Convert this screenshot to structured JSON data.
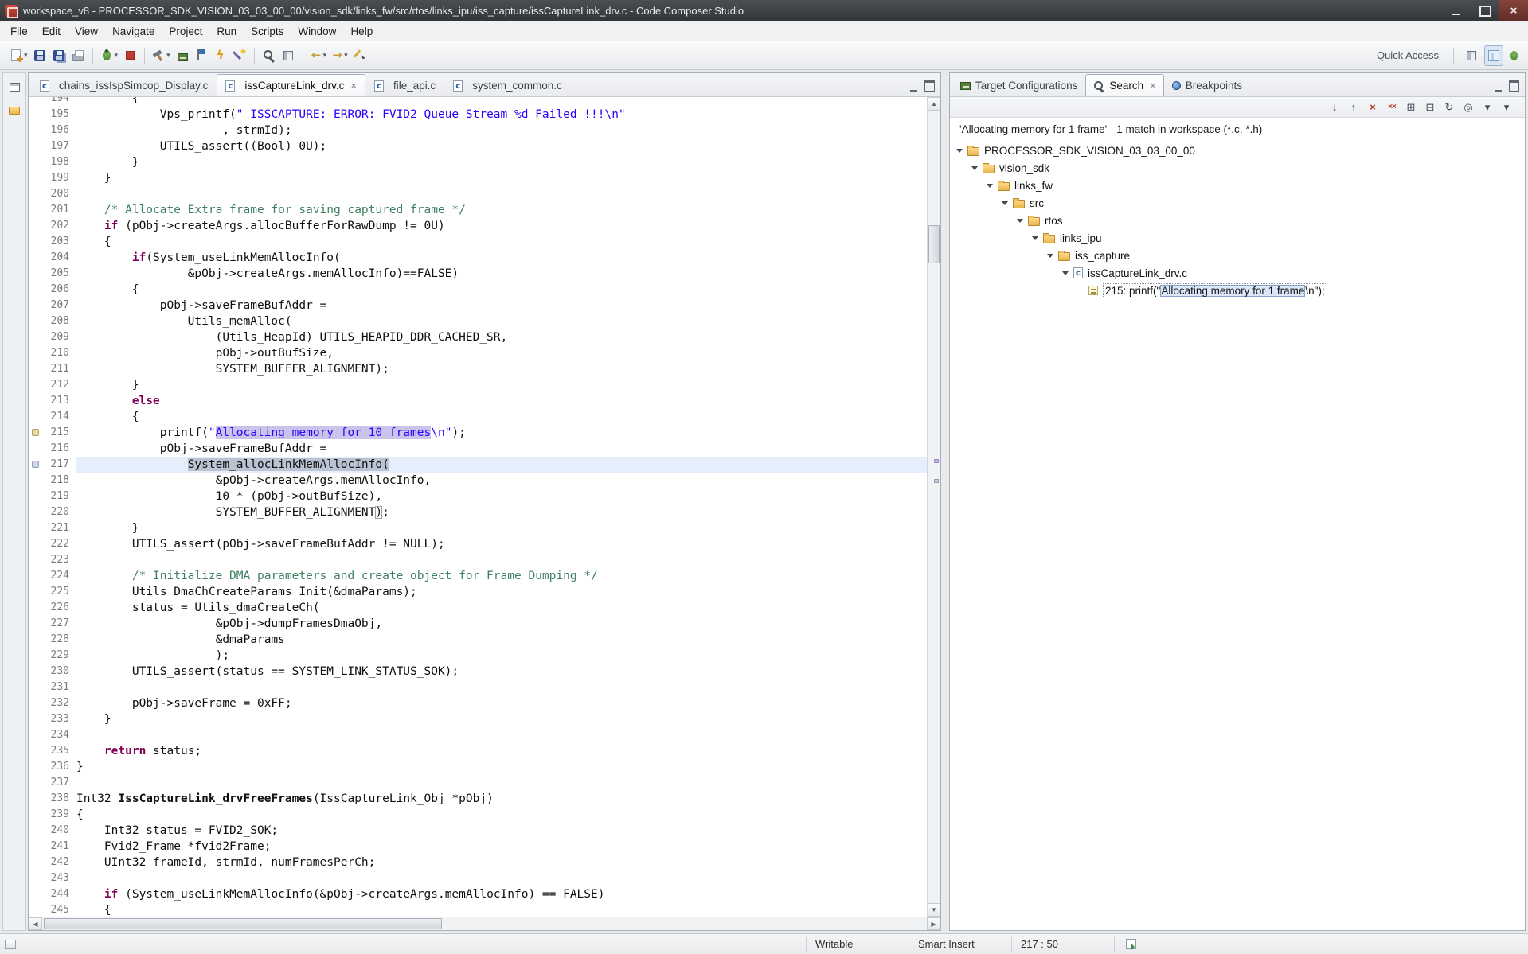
{
  "window": {
    "title": "workspace_v8 - PROCESSOR_SDK_VISION_03_03_00_00/vision_sdk/links_fw/src/rtos/links_ipu/iss_capture/issCaptureLink_drv.c - Code Composer Studio"
  },
  "menubar": {
    "items": [
      "File",
      "Edit",
      "View",
      "Navigate",
      "Project",
      "Run",
      "Scripts",
      "Window",
      "Help"
    ]
  },
  "toolbar": {
    "quick_access_label": "Quick Access",
    "buttons": [
      {
        "name": "new-button",
        "kind": "page",
        "dropdown": true
      },
      {
        "name": "save-button",
        "kind": "floppy"
      },
      {
        "name": "save-all-button",
        "kind": "floppy-all"
      },
      {
        "name": "print-button",
        "kind": "print"
      },
      {
        "sep": true
      },
      {
        "name": "debug-button",
        "kind": "bug",
        "dropdown": true
      },
      {
        "name": "stop-button",
        "kind": "stop"
      },
      {
        "sep": true
      },
      {
        "name": "build-button",
        "kind": "hammer",
        "dropdown": true
      },
      {
        "name": "new-target-configuration-button",
        "kind": "board"
      },
      {
        "name": "flag-button",
        "kind": "flag"
      },
      {
        "name": "flash-button",
        "kind": "bolt"
      },
      {
        "name": "wand-button",
        "kind": "wand"
      },
      {
        "sep": true
      },
      {
        "name": "search-button",
        "kind": "mag"
      },
      {
        "name": "open-resource-button",
        "kind": "grid"
      },
      {
        "sep": true
      },
      {
        "name": "back-button",
        "kind": "arrow-left",
        "dropdown": true
      },
      {
        "name": "forward-button",
        "kind": "arrow-right",
        "dropdown": true
      },
      {
        "name": "last-edit-location-button",
        "kind": "pencil"
      }
    ]
  },
  "editor": {
    "tabs": [
      {
        "label": "chains_issIspSimcop_Display.c",
        "active": false,
        "closable": false
      },
      {
        "label": "issCaptureLink_drv.c",
        "active": true,
        "closable": true
      },
      {
        "label": "file_api.c",
        "active": false,
        "closable": false
      },
      {
        "label": "system_common.c",
        "active": false,
        "closable": false
      }
    ],
    "code": {
      "lines": [
        {
          "n": 194,
          "segs": [
            {
              "t": "        {"
            }
          ]
        },
        {
          "n": 195,
          "segs": [
            {
              "t": "            Vps_printf("
            },
            {
              "t": "\" ISSCAPTURE: ERROR: FVID2 Queue Stream %d Failed !!!\\n\"",
              "c": "s"
            }
          ]
        },
        {
          "n": 196,
          "segs": [
            {
              "t": "                     , strmId);"
            }
          ]
        },
        {
          "n": 197,
          "segs": [
            {
              "t": "            UTILS_assert((Bool) 0U);"
            }
          ]
        },
        {
          "n": 198,
          "segs": [
            {
              "t": "        }"
            }
          ]
        },
        {
          "n": 199,
          "segs": [
            {
              "t": "    }"
            }
          ]
        },
        {
          "n": 200,
          "segs": []
        },
        {
          "n": 201,
          "segs": [
            {
              "t": "    "
            },
            {
              "t": "/* Allocate Extra frame for saving captured frame */",
              "c": "c"
            }
          ]
        },
        {
          "n": 202,
          "segs": [
            {
              "t": "    "
            },
            {
              "t": "if",
              "c": "k"
            },
            {
              "t": " (pObj->createArgs.allocBufferForRawDump != 0U)"
            }
          ]
        },
        {
          "n": 203,
          "segs": [
            {
              "t": "    {"
            }
          ]
        },
        {
          "n": 204,
          "segs": [
            {
              "t": "        "
            },
            {
              "t": "if",
              "c": "k"
            },
            {
              "t": "(System_useLinkMemAllocInfo("
            }
          ]
        },
        {
          "n": 205,
          "segs": [
            {
              "t": "                &pObj->createArgs.memAllocInfo)==FALSE)"
            }
          ]
        },
        {
          "n": 206,
          "segs": [
            {
              "t": "        {"
            }
          ]
        },
        {
          "n": 207,
          "segs": [
            {
              "t": "            pObj->saveFrameBufAddr ="
            }
          ]
        },
        {
          "n": 208,
          "segs": [
            {
              "t": "                Utils_memAlloc("
            }
          ]
        },
        {
          "n": 209,
          "segs": [
            {
              "t": "                    (Utils_HeapId) UTILS_HEAPID_DDR_CACHED_SR,"
            }
          ]
        },
        {
          "n": 210,
          "segs": [
            {
              "t": "                    pObj->outBufSize,"
            }
          ]
        },
        {
          "n": 211,
          "segs": [
            {
              "t": "                    SYSTEM_BUFFER_ALIGNMENT);"
            }
          ]
        },
        {
          "n": 212,
          "segs": [
            {
              "t": "        }"
            }
          ]
        },
        {
          "n": 213,
          "segs": [
            {
              "t": "        "
            },
            {
              "t": "else",
              "c": "k"
            }
          ]
        },
        {
          "n": 214,
          "segs": [
            {
              "t": "        {"
            }
          ]
        },
        {
          "n": 215,
          "marker": "search",
          "segs": [
            {
              "t": "            printf("
            },
            {
              "t": "\"",
              "c": "s"
            },
            {
              "t": "Allocating memory for 10 frames",
              "c": "s hl"
            },
            {
              "t": "\\n\"",
              "c": "s"
            },
            {
              "t": ");"
            }
          ]
        },
        {
          "n": 216,
          "segs": [
            {
              "t": "            pObj->saveFrameBufAddr ="
            }
          ]
        },
        {
          "n": 217,
          "cur": true,
          "marker": "occ",
          "segs": [
            {
              "t": "                "
            },
            {
              "t": "System_allocLinkMemAllocInfo(",
              "c": "sel"
            }
          ]
        },
        {
          "n": 218,
          "segs": [
            {
              "t": "                    &pObj->createArgs.memAllocInfo,"
            }
          ]
        },
        {
          "n": 219,
          "segs": [
            {
              "t": "                    10 * (pObj->outBufSize),"
            }
          ]
        },
        {
          "n": 220,
          "segs": [
            {
              "t": "                    SYSTEM_BUFFER_ALIGNMENT"
            },
            {
              "t": ")",
              "c": "br"
            },
            {
              "t": ";"
            }
          ]
        },
        {
          "n": 221,
          "segs": [
            {
              "t": "        }"
            }
          ]
        },
        {
          "n": 222,
          "segs": [
            {
              "t": "        UTILS_assert(pObj->saveFrameBufAddr != NULL);"
            }
          ]
        },
        {
          "n": 223,
          "segs": []
        },
        {
          "n": 224,
          "segs": [
            {
              "t": "        "
            },
            {
              "t": "/* Initialize DMA parameters and create object for Frame Dumping */",
              "c": "c"
            }
          ]
        },
        {
          "n": 225,
          "segs": [
            {
              "t": "        Utils_DmaChCreateParams_Init(&dmaParams);"
            }
          ]
        },
        {
          "n": 226,
          "segs": [
            {
              "t": "        status = Utils_dmaCreateCh("
            }
          ]
        },
        {
          "n": 227,
          "segs": [
            {
              "t": "                    &pObj->dumpFramesDmaObj,"
            }
          ]
        },
        {
          "n": 228,
          "segs": [
            {
              "t": "                    &dmaParams"
            }
          ]
        },
        {
          "n": 229,
          "segs": [
            {
              "t": "                    );"
            }
          ]
        },
        {
          "n": 230,
          "segs": [
            {
              "t": "        UTILS_assert(status == SYSTEM_LINK_STATUS_SOK);"
            }
          ]
        },
        {
          "n": 231,
          "segs": []
        },
        {
          "n": 232,
          "segs": [
            {
              "t": "        pObj->saveFrame = 0xFF;"
            }
          ]
        },
        {
          "n": 233,
          "segs": [
            {
              "t": "    }"
            }
          ]
        },
        {
          "n": 234,
          "segs": []
        },
        {
          "n": 235,
          "segs": [
            {
              "t": "    "
            },
            {
              "t": "return",
              "c": "k"
            },
            {
              "t": " status;"
            }
          ]
        },
        {
          "n": 236,
          "segs": [
            {
              "t": "}"
            }
          ]
        },
        {
          "n": 237,
          "segs": []
        },
        {
          "n": 238,
          "segs": [
            {
              "t": "Int32 "
            },
            {
              "t": "IssCaptureLink_drvFreeFrames",
              "c": "fn"
            },
            {
              "t": "(IssCaptureLink_Obj *pObj)"
            }
          ]
        },
        {
          "n": 239,
          "segs": [
            {
              "t": "{"
            }
          ]
        },
        {
          "n": 240,
          "segs": [
            {
              "t": "    Int32 status = FVID2_SOK;"
            }
          ]
        },
        {
          "n": 241,
          "segs": [
            {
              "t": "    Fvid2_Frame *fvid2Frame;"
            }
          ]
        },
        {
          "n": 242,
          "segs": [
            {
              "t": "    UInt32 frameId, strmId, numFramesPerCh;"
            }
          ]
        },
        {
          "n": 243,
          "segs": []
        },
        {
          "n": 244,
          "segs": [
            {
              "t": "    "
            },
            {
              "t": "if",
              "c": "k"
            },
            {
              "t": " (System_useLinkMemAllocInfo(&pObj->createArgs.memAllocInfo) == FALSE)"
            }
          ]
        },
        {
          "n": 245,
          "segs": [
            {
              "t": "    {"
            }
          ]
        }
      ]
    }
  },
  "search_panel": {
    "tabs": [
      {
        "label": "Target Configurations",
        "icon": "target",
        "active": false,
        "closable": false
      },
      {
        "label": "Search",
        "icon": "magnifier",
        "active": true,
        "closable": true
      },
      {
        "label": "Breakpoints",
        "icon": "breakpoint",
        "active": false,
        "closable": false
      }
    ],
    "toolbar": [
      {
        "name": "next-match-button",
        "kind": "arrow-down"
      },
      {
        "name": "previous-match-button",
        "kind": "arrow-up"
      },
      {
        "name": "remove-selected-matches-button",
        "kind": "x"
      },
      {
        "name": "remove-all-matches-button",
        "kind": "xx"
      },
      {
        "name": "expand-all-button",
        "kind": "expand"
      },
      {
        "name": "collapse-all-button",
        "kind": "collapse"
      },
      {
        "name": "run-search-again-button",
        "kind": "refresh"
      },
      {
        "name": "pin-search-view-button",
        "kind": "pin"
      },
      {
        "name": "previous-searches-button",
        "kind": "dropdown"
      },
      {
        "name": "view-menu-button",
        "kind": "menu"
      }
    ],
    "summary": "'Allocating memory for 1 frame' - 1 match in workspace (*.c, *.h)",
    "tree": [
      {
        "label": "PROCESSOR_SDK_VISION_03_03_00_00",
        "depth": 0,
        "icon": "folder",
        "expanded": true
      },
      {
        "label": "vision_sdk",
        "depth": 1,
        "icon": "folder",
        "expanded": true
      },
      {
        "label": "links_fw",
        "depth": 2,
        "icon": "folder",
        "expanded": true
      },
      {
        "label": "src",
        "depth": 3,
        "icon": "folder",
        "expanded": true
      },
      {
        "label": "rtos",
        "depth": 4,
        "icon": "folder",
        "expanded": true
      },
      {
        "label": "links_ipu",
        "depth": 5,
        "icon": "folder",
        "expanded": true
      },
      {
        "label": "iss_capture",
        "depth": 6,
        "icon": "folder",
        "expanded": true
      },
      {
        "label": "issCaptureLink_drv.c",
        "depth": 7,
        "icon": "cfile",
        "expanded": true
      },
      {
        "depth": 8,
        "icon": "match",
        "prefix": "215: printf(\"",
        "match": "Allocating memory for 1 frame",
        "suffix": "\\n\");"
      }
    ]
  },
  "statusbar": {
    "writable": "Writable",
    "insert_mode": "Smart Insert",
    "position": "217 : 50"
  }
}
